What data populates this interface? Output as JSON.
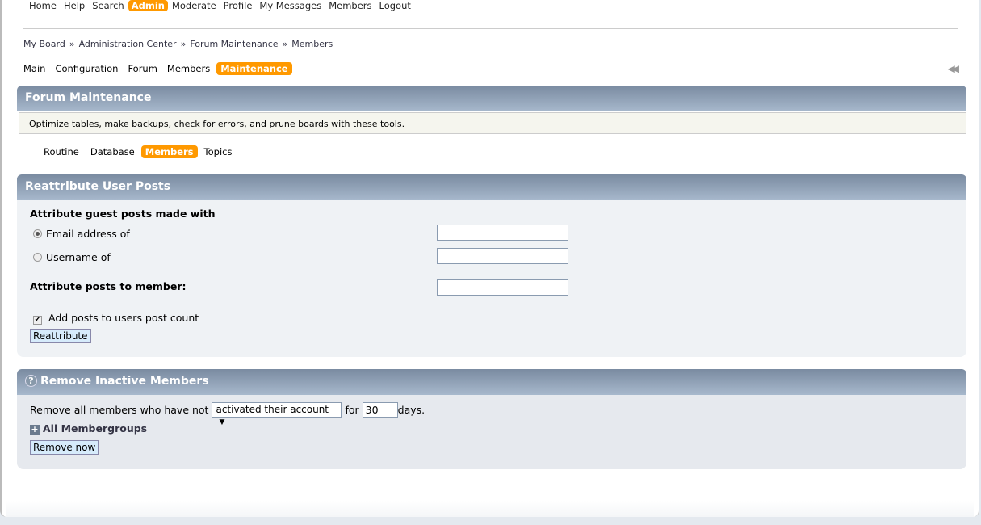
{
  "topnav": [
    "Home",
    "Help",
    "Search",
    "Admin",
    "Moderate",
    "Profile",
    "My Messages",
    "Members",
    "Logout"
  ],
  "breadcrumb": [
    "My Board",
    "Administration Center",
    "Forum Maintenance",
    "Members"
  ],
  "breadcrumb_sep": "»",
  "subnav": [
    "Main",
    "Configuration",
    "Forum",
    "Members",
    "Maintenance"
  ],
  "forum_maintenance": {
    "title": "Forum Maintenance",
    "description": "Optimize tables, make backups, check for errors, and prune boards with these tools.",
    "tabs": [
      "Routine",
      "Database",
      "Members",
      "Topics"
    ]
  },
  "reattribute": {
    "title": "Reattribute User Posts",
    "guest_heading": "Attribute guest posts made with",
    "email_label": "Email address of",
    "username_label": "Username of",
    "member_label": "Attribute posts to member:",
    "email_value": "",
    "username_value": "",
    "member_value": "",
    "selected_option": "email",
    "add_count_label": "Add posts to users post count",
    "add_count_checked": true,
    "button": "Reattribute"
  },
  "inactive": {
    "title": "Remove Inactive Members",
    "text_before": "Remove all members who have not",
    "select_value": "activated their account",
    "text_for": "for",
    "days_value": "30",
    "text_after": "days.",
    "groups_label": "All Membergroups",
    "button": "Remove now"
  },
  "colors": {
    "accent": "#ff9900",
    "header_bar": "#8899af"
  }
}
